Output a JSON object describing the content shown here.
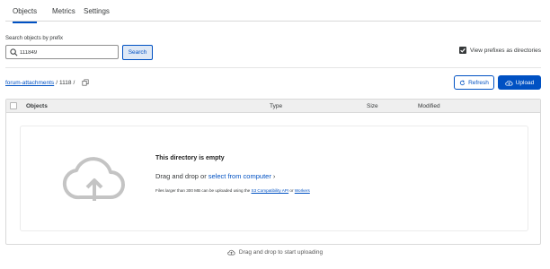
{
  "tabs": [
    {
      "label": "Objects",
      "active": true
    },
    {
      "label": "Metrics",
      "active": false
    },
    {
      "label": "Settings",
      "active": false
    }
  ],
  "search": {
    "label": "Search objects by prefix",
    "value": "111849",
    "button_label": "Search"
  },
  "view_prefixes": {
    "label": "View prefixes as directories",
    "checked": true
  },
  "breadcrumb": {
    "root": "forum-attachments",
    "sep1": "/",
    "folder": "1118",
    "sep2": "/"
  },
  "actions": {
    "refresh_label": "Refresh",
    "upload_label": "Upload"
  },
  "table": {
    "columns": [
      "Objects",
      "Type",
      "Size",
      "Modified"
    ]
  },
  "empty_state": {
    "title": "This directory is empty",
    "drag_prefix": "Drag and drop or",
    "drag_link": "select from computer",
    "drag_chevron": "›",
    "note_prefix": "Files larger than 300 MB can be uploaded using the",
    "note_link1": "S3 Compatibility API",
    "note_mid": "or",
    "note_link2": "Workers"
  },
  "footer_hint": "Drag and drop to start uploading",
  "colors": {
    "accent": "#0051c3",
    "text": "#36393a",
    "border": "#d9d9d9"
  }
}
